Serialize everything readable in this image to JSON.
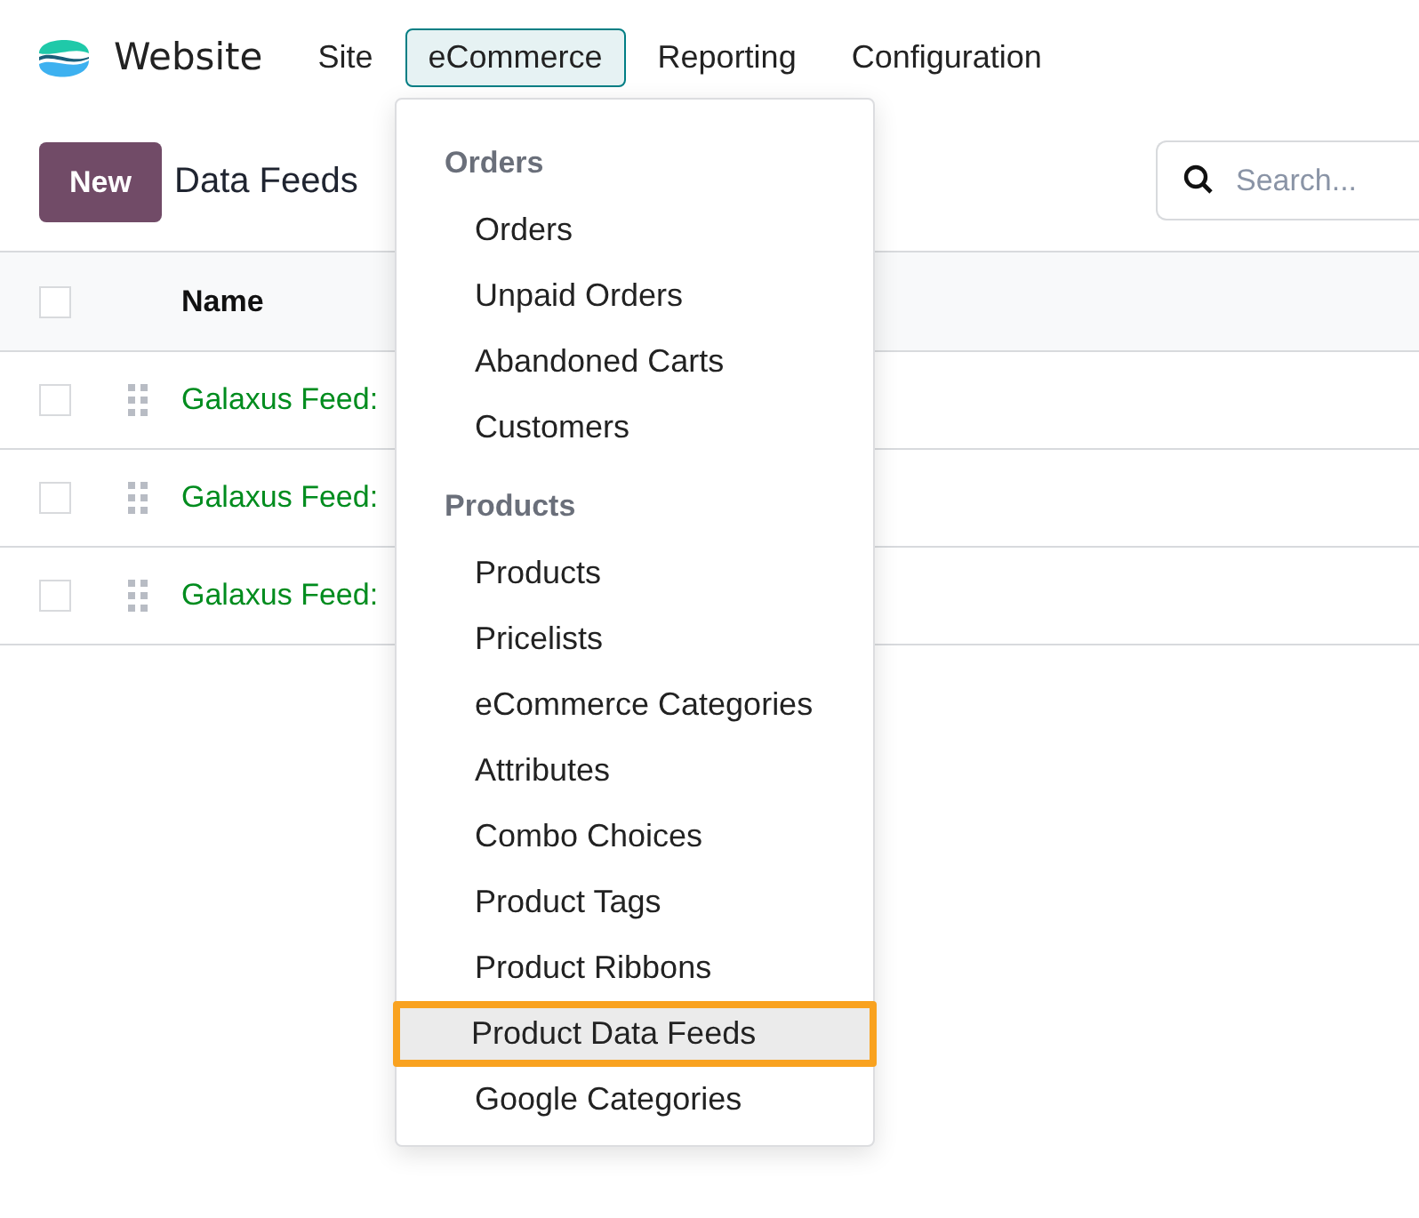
{
  "navbar": {
    "app_name": "Website",
    "menus": [
      {
        "label": "Site",
        "selected": false
      },
      {
        "label": "eCommerce",
        "selected": true
      },
      {
        "label": "Reporting",
        "selected": false
      },
      {
        "label": "Configuration",
        "selected": false
      }
    ]
  },
  "control_panel": {
    "new_button": "New",
    "title": "Data Feeds",
    "search": {
      "placeholder": "Search..."
    }
  },
  "table": {
    "all_checked": false,
    "columns": [
      "Name"
    ],
    "rows": [
      {
        "name": "Galaxus Feed:",
        "checked": false
      },
      {
        "name": "Galaxus Feed:",
        "checked": false
      },
      {
        "name": "Galaxus Feed:",
        "checked": false
      }
    ]
  },
  "dropdown": {
    "sections": [
      {
        "title": "Orders",
        "items": [
          {
            "label": "Orders",
            "highlighted": false
          },
          {
            "label": "Unpaid Orders",
            "highlighted": false
          },
          {
            "label": "Abandoned Carts",
            "highlighted": false
          },
          {
            "label": "Customers",
            "highlighted": false
          }
        ]
      },
      {
        "title": "Products",
        "items": [
          {
            "label": "Products",
            "highlighted": false
          },
          {
            "label": "Pricelists",
            "highlighted": false
          },
          {
            "label": "eCommerce Categories",
            "highlighted": false
          },
          {
            "label": "Attributes",
            "highlighted": false
          },
          {
            "label": "Combo Choices",
            "highlighted": false
          },
          {
            "label": "Product Tags",
            "highlighted": false
          },
          {
            "label": "Product Ribbons",
            "highlighted": false
          },
          {
            "label": "Product Data Feeds",
            "highlighted": true
          },
          {
            "label": "Google Categories",
            "highlighted": false
          }
        ]
      }
    ]
  }
}
